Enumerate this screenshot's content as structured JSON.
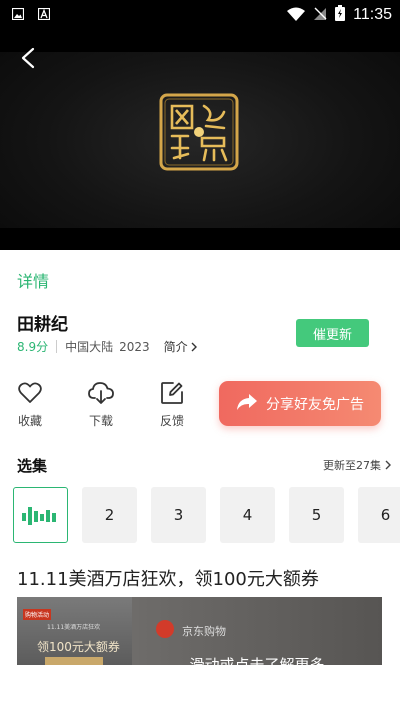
{
  "status_bar": {
    "time": "11:35"
  },
  "video": {
    "back_icon": "chevron-left-icon",
    "logo_icon": "gold-seal-logo"
  },
  "details": {
    "tab_label": "详情",
    "title": "田耕纪",
    "score": "8.9分",
    "region": "中国大陆",
    "year": "2023",
    "intro_label": "简介",
    "urge_update_label": "催更新"
  },
  "actions": [
    {
      "label": "收藏",
      "icon": "heart-icon"
    },
    {
      "label": "下载",
      "icon": "cloud-download-icon"
    },
    {
      "label": "反馈",
      "icon": "edit-icon"
    }
  ],
  "share_button": {
    "label": "分享好友免广告",
    "icon": "share-arrow-icon"
  },
  "episodes": {
    "section_title": "选集",
    "update_status": "更新至27集",
    "items": [
      "",
      "2",
      "3",
      "4",
      "5",
      "6"
    ],
    "active_index": 0
  },
  "ad": {
    "title": "11.11美酒万店狂欢，领100元大额券",
    "tag": "购物活动",
    "subtitle": "11.11美酒万店狂欢",
    "coupon": "领100元大额券",
    "brand": "京东购物",
    "cta": "滑动或点击了解更多"
  },
  "colors": {
    "accent": "#2bb673",
    "button_green": "#44c97c",
    "share_red": "#f0695f"
  }
}
